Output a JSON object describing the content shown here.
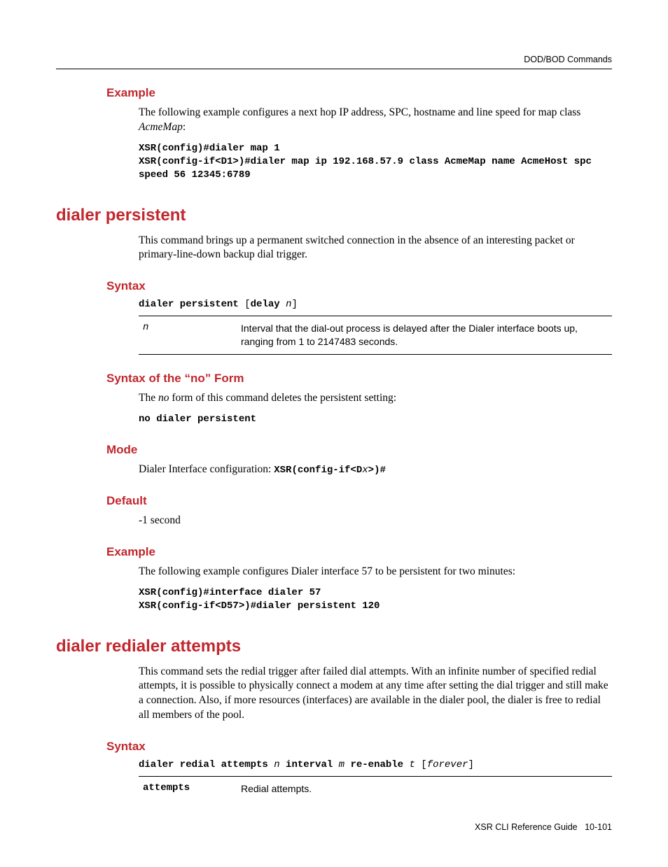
{
  "running_head": "DOD/BOD Commands",
  "example1": {
    "heading": "Example",
    "intro_a": "The following example configures a next hop IP address, SPC, hostname and line speed for map class ",
    "intro_em": "AcmeMap",
    "intro_b": ":",
    "code": "XSR(config)#dialer map 1\nXSR(config-if<D1>)#dialer map ip 192.168.57.9 class AcmeMap name AcmeHost spc speed 56 12345:6789"
  },
  "dialer_persistent": {
    "title": "dialer persistent",
    "desc": "This command brings up a permanent switched connection in the absence of an interesting packet or primary-line-down backup dial trigger.",
    "syntax_heading": "Syntax",
    "syntax_kw1": "dialer persistent ",
    "syntax_br1": "[",
    "syntax_kw2": "delay ",
    "syntax_arg": "n",
    "syntax_br2": "]",
    "param_name": "n",
    "param_desc": "Interval that the dial-out process is delayed after the Dialer interface boots up, ranging from 1 to 2147483 seconds.",
    "no_heading": "Syntax of the “no” Form",
    "no_intro_a": "The ",
    "no_intro_em": "no",
    "no_intro_b": " form of this command deletes the persistent setting:",
    "no_code": "no dialer persistent",
    "mode_heading": "Mode",
    "mode_text": "Dialer Interface configuration: ",
    "mode_prompt": "XSR(config-if<Dx>)#",
    "default_heading": "Default",
    "default_text": "-1 second",
    "ex_heading": "Example",
    "ex_intro": "The following example configures Dialer interface 57 to be persistent for two minutes:",
    "ex_code": "XSR(config)#interface dialer 57\nXSR(config-if<D57>)#dialer persistent 120"
  },
  "dialer_redial": {
    "title": "dialer redialer attempts",
    "desc": "This command sets the redial trigger after failed dial attempts. With an infinite number of specified redial attempts, it is possible to physically connect a modem at any time after setting the dial trigger and still make a connection. Also, if more resources (interfaces) are available in the dialer pool, the dialer is free to redial all members of the pool.",
    "syntax_heading": "Syntax",
    "syn_kw1": "dialer redial attempts ",
    "syn_arg1": "n",
    "syn_kw2": " interval ",
    "syn_arg2": "m",
    "syn_kw3": " re-enable ",
    "syn_arg3": "t",
    "syn_br1": " [",
    "syn_arg4": "forever",
    "syn_br2": "]",
    "param_name": "attempts",
    "param_desc": "Redial attempts."
  },
  "footer_a": "XSR CLI Reference Guide",
  "footer_b": "10-101"
}
